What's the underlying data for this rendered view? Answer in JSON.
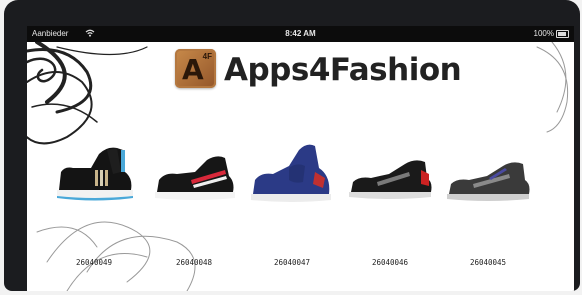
{
  "status_bar": {
    "carrier": "Aanbieder",
    "time": "8:42 AM",
    "battery": "100%"
  },
  "app": {
    "logo_letter": "A",
    "logo_superscript": "4F",
    "title": "Apps4Fashion"
  },
  "products": [
    {
      "code": "26040049",
      "colors": {
        "upper": "#141414",
        "stripe": "#c8b48a",
        "sole": "#f2f2f2",
        "accent": "#4aa8d8"
      }
    },
    {
      "code": "26040048",
      "colors": {
        "upper": "#161616",
        "stripe": "#d8283a",
        "sole": "#f4f4f4",
        "accent": "#d8283a"
      }
    },
    {
      "code": "26040047",
      "colors": {
        "upper": "#2b3a86",
        "stripe": "#cfcfcf",
        "sole": "#ececec",
        "accent": "#c03030"
      }
    },
    {
      "code": "26040046",
      "colors": {
        "upper": "#1a1a1a",
        "stripe": "#7a7a7a",
        "sole": "#dddddd",
        "accent": "#cc2222"
      }
    },
    {
      "code": "26040045",
      "colors": {
        "upper": "#3a3a3a",
        "stripe": "#8a8a8a",
        "sole": "#cfcfcf",
        "accent": "#4a4aa0"
      }
    }
  ]
}
